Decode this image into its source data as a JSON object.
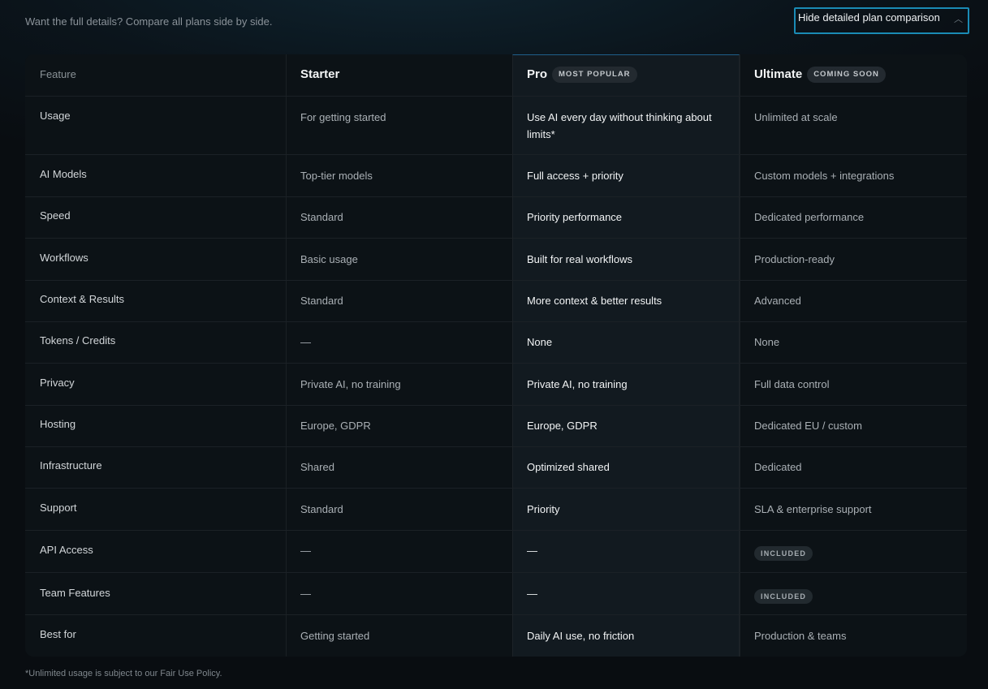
{
  "intro": "Want the full details? Compare all plans side by side.",
  "toggle": {
    "label": "Hide detailed plan comparison",
    "icon": "chevron-up-icon"
  },
  "header": {
    "feature": "Feature",
    "plans": [
      {
        "name": "Starter",
        "badge": ""
      },
      {
        "name": "Pro",
        "badge": "MOST POPULAR"
      },
      {
        "name": "Ultimate",
        "badge": "COMING SOON"
      }
    ]
  },
  "rows": [
    {
      "feature": "Usage",
      "values": [
        "For getting started",
        "Use AI every day without thinking about limits*",
        "Unlimited at scale"
      ]
    },
    {
      "feature": "AI Models",
      "values": [
        "Top-tier models",
        "Full access + priority",
        "Custom models + integrations"
      ]
    },
    {
      "feature": "Speed",
      "values": [
        "Standard",
        "Priority performance",
        "Dedicated performance"
      ]
    },
    {
      "feature": "Workflows",
      "values": [
        "Basic usage",
        "Built for real workflows",
        "Production-ready"
      ]
    },
    {
      "feature": "Context & Results",
      "values": [
        "Standard",
        "More context & better results",
        "Advanced"
      ]
    },
    {
      "feature": "Tokens / Credits",
      "values": [
        "—",
        "None",
        "None"
      ]
    },
    {
      "feature": "Privacy",
      "values": [
        "Private AI, no training",
        "Private AI, no training",
        "Full data control"
      ]
    },
    {
      "feature": "Hosting",
      "values": [
        "Europe, GDPR",
        "Europe, GDPR",
        "Dedicated EU / custom"
      ]
    },
    {
      "feature": "Infrastructure",
      "values": [
        "Shared",
        "Optimized shared",
        "Dedicated"
      ]
    },
    {
      "feature": "Support",
      "values": [
        "Standard",
        "Priority",
        "SLA & enterprise support"
      ]
    },
    {
      "feature": "API Access",
      "values": [
        "—",
        "—",
        "INCLUDED"
      ]
    },
    {
      "feature": "Team Features",
      "values": [
        "—",
        "—",
        "INCLUDED"
      ]
    },
    {
      "feature": "Best for",
      "values": [
        "Getting started",
        "Daily AI use, no friction",
        "Production & teams"
      ]
    }
  ],
  "footnote": "*Unlimited usage is subject to our Fair Use Policy."
}
